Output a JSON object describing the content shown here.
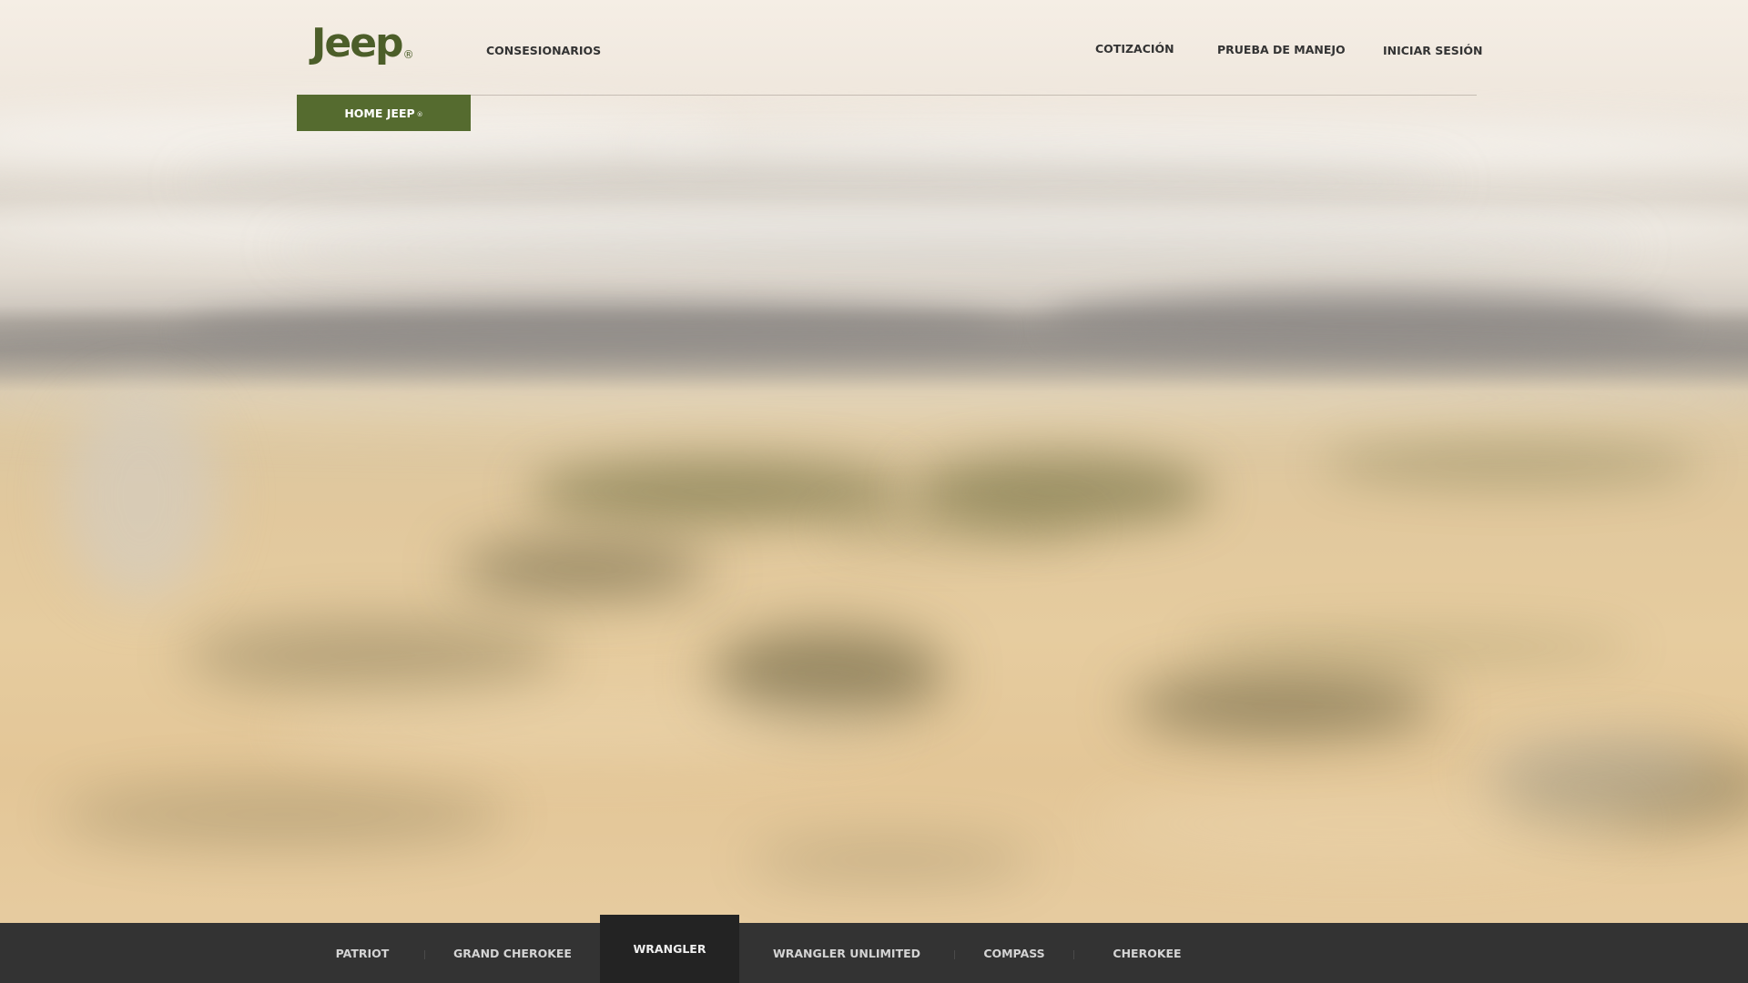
{
  "brand": {
    "logo_text": "Jeep",
    "logo_mark": "®",
    "accent_color": "#556b2f"
  },
  "header": {
    "nav_left": [
      {
        "label": "CONSESIONARIOS"
      }
    ],
    "nav_right": [
      {
        "label": "COTIZACIÓN"
      },
      {
        "label": "PRUEBA DE MANEJO"
      },
      {
        "label": "INICIAR SESIÓN"
      }
    ]
  },
  "home_tab": {
    "label": "HOME JEEP",
    "mark": "®"
  },
  "hero": {
    "image": "blurred-desert-landscape"
  },
  "model_bar": {
    "background_color": "#333333",
    "active_index": 2,
    "items": [
      {
        "label": "PATRIOT"
      },
      {
        "label": "GRAND CHEROKEE"
      },
      {
        "label": "WRANGLER"
      },
      {
        "label": "WRANGLER UNLIMITED"
      },
      {
        "label": "COMPASS"
      },
      {
        "label": "CHEROKEE"
      }
    ]
  }
}
